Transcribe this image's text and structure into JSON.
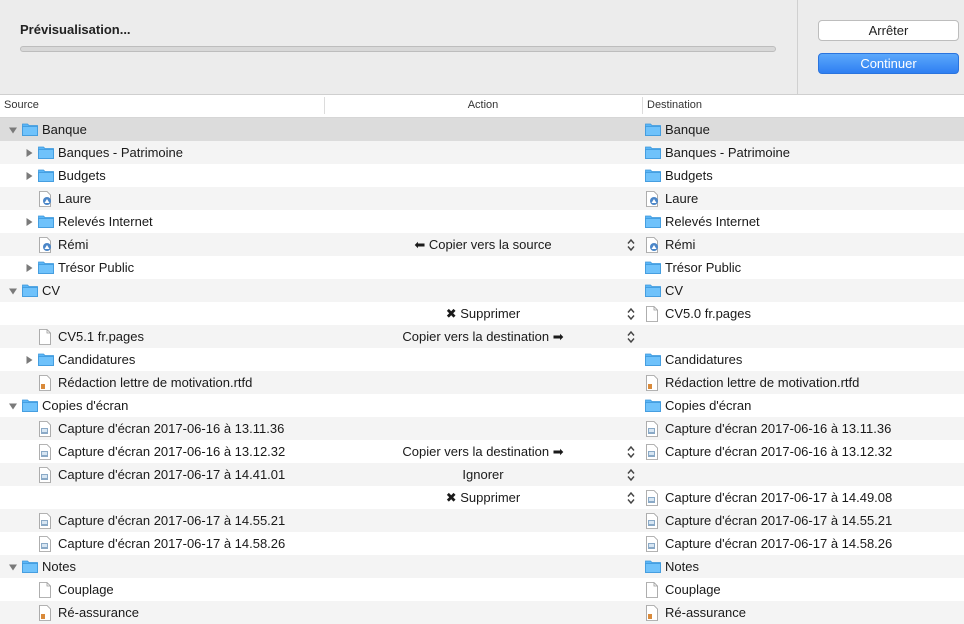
{
  "status": {
    "title": "Prévisualisation...",
    "progress": 0
  },
  "buttons": {
    "stop": "Arrêter",
    "continue": "Continuer"
  },
  "columns": {
    "source": "Source",
    "action": "Action",
    "destination": "Destination"
  },
  "colors": {
    "accent": "#3a8ef5",
    "folder": "#5bb6f7",
    "selected_row": "#dcdcdc"
  },
  "rows": [
    {
      "level": 0,
      "expander": "down",
      "src": "Banque",
      "src_icon": "folder-icon",
      "action": "",
      "dst": "Banque",
      "dst_icon": "folder-icon",
      "selected": true
    },
    {
      "level": 1,
      "expander": "right",
      "src": "Banques - Patrimoine",
      "src_icon": "folder-icon",
      "action": "",
      "dst": "Banques - Patrimoine",
      "dst_icon": "folder-icon"
    },
    {
      "level": 1,
      "expander": "right",
      "src": "Budgets",
      "src_icon": "folder-icon",
      "action": "",
      "dst": "Budgets",
      "dst_icon": "folder-icon"
    },
    {
      "level": 1,
      "expander": "none",
      "src": "Laure",
      "src_icon": "alias-icon",
      "action": "",
      "dst": "Laure",
      "dst_icon": "alias-icon"
    },
    {
      "level": 1,
      "expander": "right",
      "src": "Relevés Internet",
      "src_icon": "folder-icon",
      "action": "",
      "dst": "Relevés Internet",
      "dst_icon": "folder-icon"
    },
    {
      "level": 1,
      "expander": "none",
      "src": "Rémi",
      "src_icon": "alias-icon",
      "action": "⬅ Copier vers la source",
      "dst": "Rémi",
      "dst_icon": "alias-icon",
      "stepper": true
    },
    {
      "level": 1,
      "expander": "right",
      "src": "Trésor Public",
      "src_icon": "folder-icon",
      "action": "",
      "dst": "Trésor Public",
      "dst_icon": "folder-icon"
    },
    {
      "level": 0,
      "expander": "down",
      "src": "CV",
      "src_icon": "folder-icon",
      "action": "",
      "dst": "CV",
      "dst_icon": "folder-icon"
    },
    {
      "level": 1,
      "expander": "none",
      "src": "",
      "src_icon": "",
      "action": "✖ Supprimer",
      "dst": "CV5.0 fr.pages",
      "dst_icon": "file-icon",
      "stepper": true
    },
    {
      "level": 1,
      "expander": "none",
      "src": "CV5.1 fr.pages",
      "src_icon": "file-icon",
      "action": "Copier vers la destination ➡",
      "dst": "",
      "dst_icon": "",
      "stepper": true
    },
    {
      "level": 1,
      "expander": "right",
      "src": "Candidatures",
      "src_icon": "folder-icon",
      "action": "",
      "dst": "Candidatures",
      "dst_icon": "folder-icon"
    },
    {
      "level": 1,
      "expander": "none",
      "src": "Rédaction lettre de motivation.rtfd",
      "src_icon": "rtfd-icon",
      "action": "",
      "dst": "Rédaction lettre de motivation.rtfd",
      "dst_icon": "rtfd-icon"
    },
    {
      "level": 0,
      "expander": "down",
      "src": "Copies d'écran",
      "src_icon": "folder-icon",
      "action": "",
      "dst": "Copies d'écran",
      "dst_icon": "folder-icon"
    },
    {
      "level": 1,
      "expander": "none",
      "src": "Capture d'écran 2017-06-16 à 13.11.36",
      "src_icon": "image-file-icon",
      "action": "",
      "dst": "Capture d'écran 2017-06-16 à 13.11.36",
      "dst_icon": "image-file-icon"
    },
    {
      "level": 1,
      "expander": "none",
      "src": "Capture d'écran 2017-06-16 à 13.12.32",
      "src_icon": "image-file-icon",
      "action": "Copier vers la destination ➡",
      "dst": "Capture d'écran 2017-06-16 à 13.12.32",
      "dst_icon": "image-file-icon",
      "stepper": true
    },
    {
      "level": 1,
      "expander": "none",
      "src": "Capture d'écran 2017-06-17 à 14.41.01",
      "src_icon": "image-file-icon",
      "action": "Ignorer",
      "dst": "",
      "dst_icon": "",
      "stepper": true
    },
    {
      "level": 1,
      "expander": "none",
      "src": "",
      "src_icon": "",
      "action": "✖ Supprimer",
      "dst": "Capture d'écran 2017-06-17 à 14.49.08",
      "dst_icon": "image-file-icon",
      "stepper": true
    },
    {
      "level": 1,
      "expander": "none",
      "src": "Capture d'écran 2017-06-17 à 14.55.21",
      "src_icon": "image-file-icon",
      "action": "",
      "dst": "Capture d'écran 2017-06-17 à 14.55.21",
      "dst_icon": "image-file-icon"
    },
    {
      "level": 1,
      "expander": "none",
      "src": "Capture d'écran 2017-06-17 à 14.58.26",
      "src_icon": "image-file-icon",
      "action": "",
      "dst": "Capture d'écran 2017-06-17 à 14.58.26",
      "dst_icon": "image-file-icon"
    },
    {
      "level": 0,
      "expander": "down",
      "src": "Notes",
      "src_icon": "folder-icon",
      "action": "",
      "dst": "Notes",
      "dst_icon": "folder-icon"
    },
    {
      "level": 1,
      "expander": "none",
      "src": "Couplage",
      "src_icon": "file-icon",
      "action": "",
      "dst": "Couplage",
      "dst_icon": "file-icon"
    },
    {
      "level": 1,
      "expander": "none",
      "src": "Ré-assurance",
      "src_icon": "rtfd-icon",
      "action": "",
      "dst": "Ré-assurance",
      "dst_icon": "rtfd-icon"
    }
  ]
}
